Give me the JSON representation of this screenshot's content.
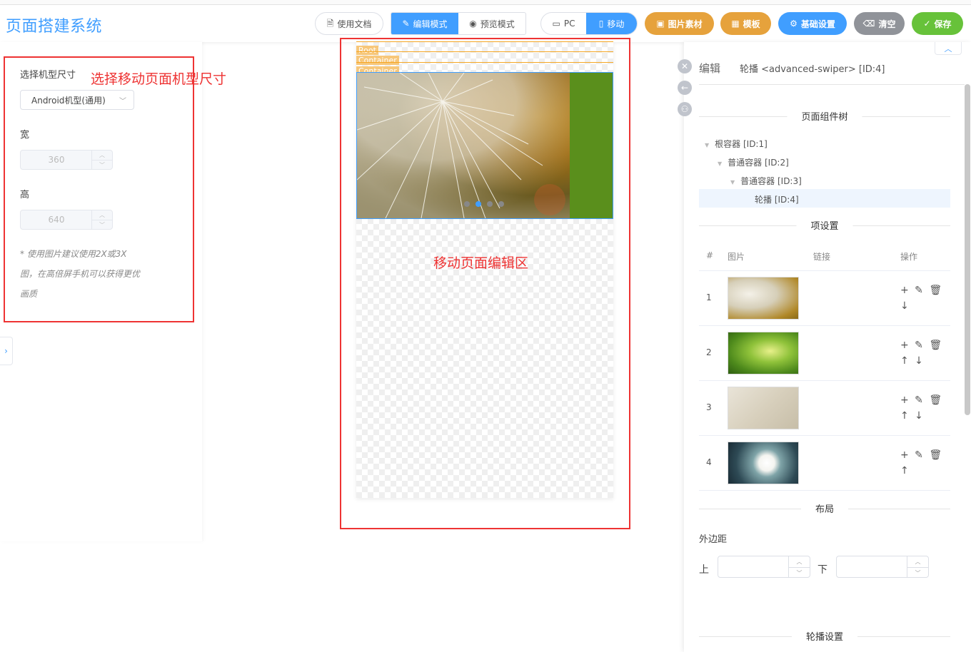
{
  "app": {
    "title": "页面搭建系统"
  },
  "toolbar": {
    "docs": "使用文档",
    "edit_mode": "编辑模式",
    "preview_mode": "预览模式",
    "pc": "PC",
    "mobile": "移动",
    "images": "图片素材",
    "templates": "模板",
    "settings": "基础设置",
    "clear": "清空",
    "save": "保存",
    "colors": {
      "primary": "#409eff",
      "orange": "#e6a23c",
      "gray": "#909399",
      "green": "#67c23a"
    }
  },
  "left": {
    "device_label": "选择机型尺寸",
    "device_value": "Android机型(通用)",
    "width_label": "宽",
    "width_value": "360",
    "height_label": "高",
    "height_value": "640",
    "note": "* 使用图片建议使用2X或3X图，在高倍屏手机可以获得更优画质",
    "annotation": "选择移动页面机型尺寸"
  },
  "canvas": {
    "tags": [
      "Root",
      "Container",
      "Container"
    ],
    "annotation": "移动页面编辑区",
    "swiper_dots": 4,
    "active_dot": 2
  },
  "right": {
    "edit_label": "编辑",
    "component_title": "轮播 <advanced-swiper> [ID:4]",
    "tree_title": "页面组件树",
    "tree": [
      {
        "label": "根容器 [ID:1]",
        "level": 0,
        "expanded": true
      },
      {
        "label": "普通容器 [ID:2]",
        "level": 1,
        "expanded": true
      },
      {
        "label": "普通容器 [ID:3]",
        "level": 2,
        "expanded": true
      },
      {
        "label": "轮播 [ID:4]",
        "level": 3,
        "selected": true
      }
    ],
    "items_title": "项设置",
    "columns": [
      "#",
      "图片",
      "链接",
      "操作"
    ],
    "items": [
      {
        "index": "1",
        "ops": "+ ✎ 🗑",
        "ops2": "↓"
      },
      {
        "index": "2",
        "ops": "+ ✎ 🗑",
        "ops2": "↑ ↓"
      },
      {
        "index": "3",
        "ops": "+ ✎ 🗑",
        "ops2": "↑ ↓"
      },
      {
        "index": "4",
        "ops": "+ ✎ 🗑",
        "ops2": "↑"
      }
    ],
    "layout_title": "布局",
    "margin_label": "外边距",
    "top_label": "上",
    "bottom_label": "下",
    "swiper_settings_title": "轮播设置"
  }
}
